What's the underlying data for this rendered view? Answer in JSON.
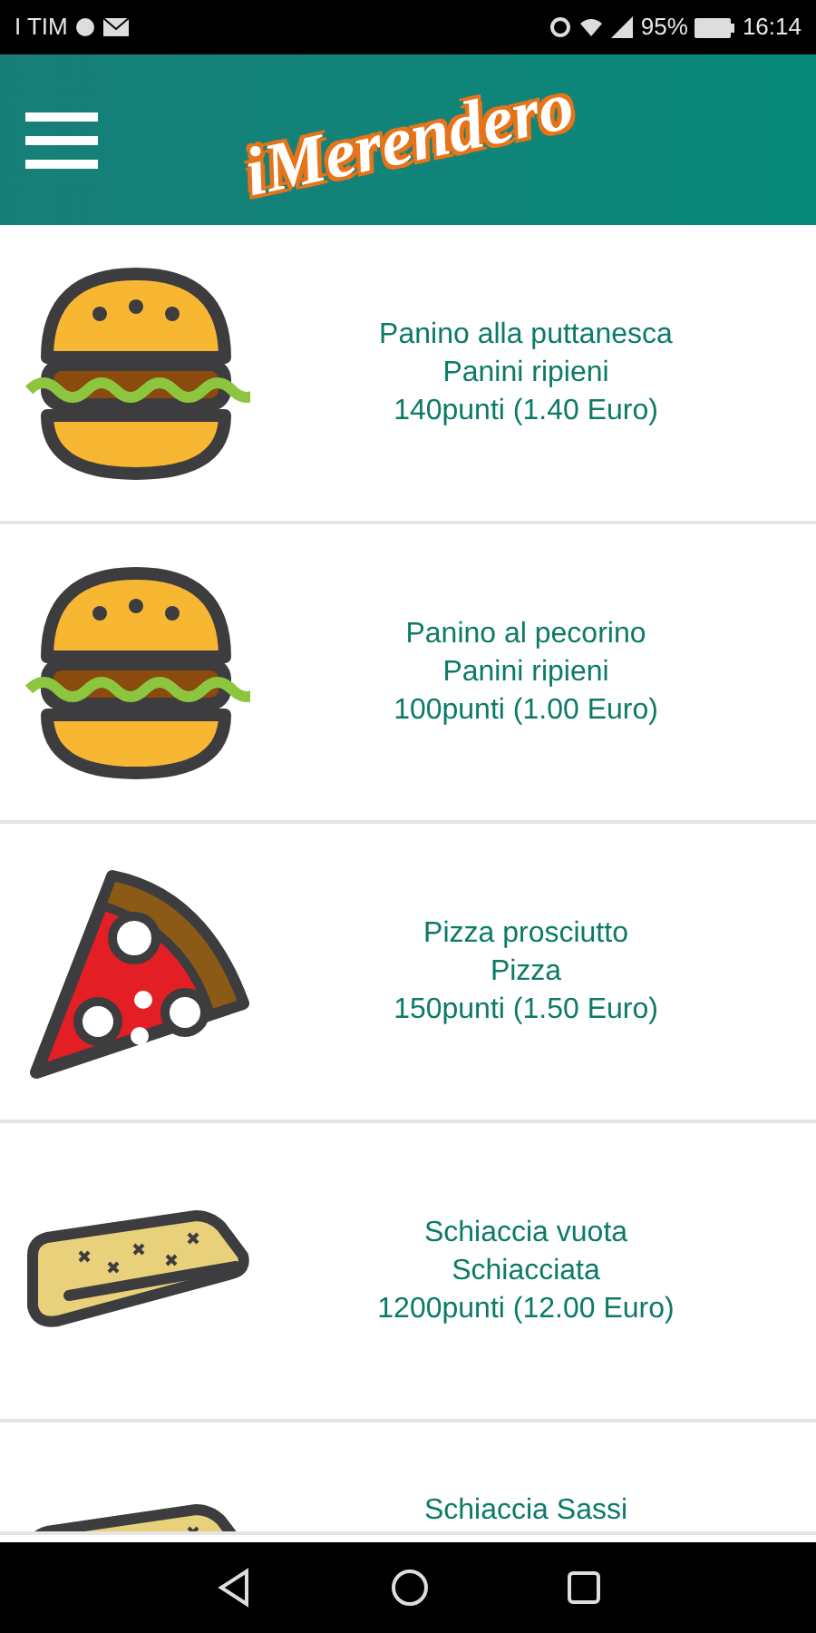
{
  "status_bar": {
    "carrier": "I TIM",
    "battery": "95%",
    "time": "16:14"
  },
  "header": {
    "logo": "iMerendero"
  },
  "items": [
    {
      "kind": "burger",
      "name": "Panino alla puttanesca",
      "category": "Panini ripieni",
      "price": "140punti (1.40 Euro)"
    },
    {
      "kind": "burger",
      "name": "Panino al pecorino",
      "category": "Panini ripieni",
      "price": "100punti (1.00 Euro)"
    },
    {
      "kind": "pizza",
      "name": "Pizza prosciutto",
      "category": "Pizza",
      "price": "150punti (1.50 Euro)"
    },
    {
      "kind": "flatbread",
      "name": "Schiaccia vuota",
      "category": "Schiacciata",
      "price": "1200punti (12.00 Euro)"
    },
    {
      "kind": "flatbread",
      "name": "Schiaccia Sassi"
    }
  ]
}
